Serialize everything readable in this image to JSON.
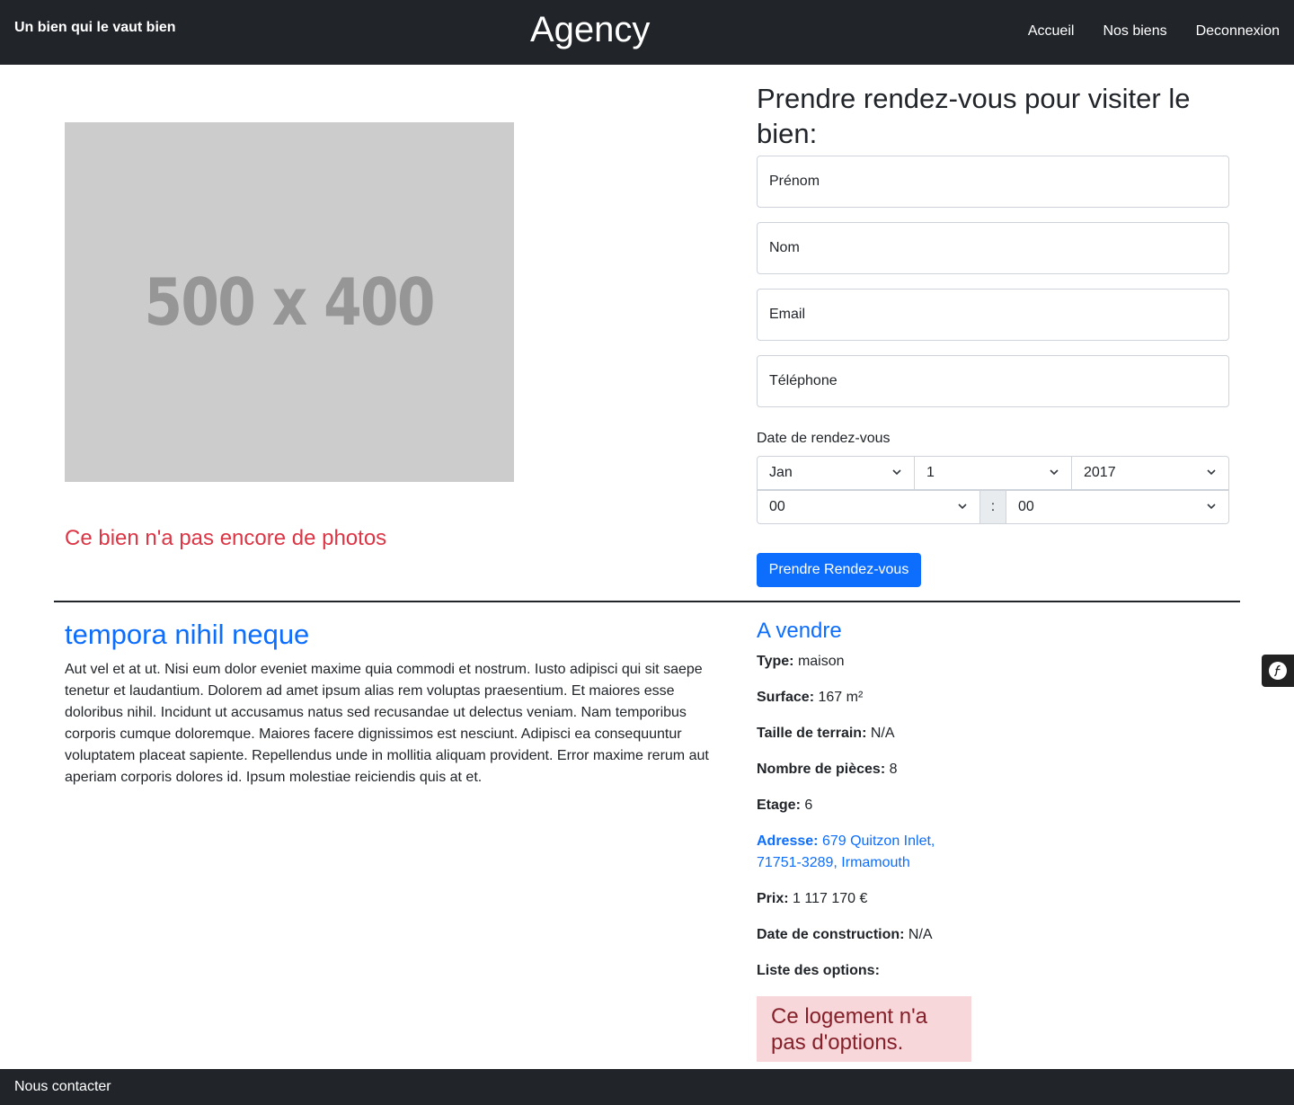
{
  "header": {
    "tagline": "Un bien qui le vaut bien",
    "brand": "Agency",
    "nav": [
      "Accueil",
      "Nos biens",
      "Deconnexion"
    ]
  },
  "gallery": {
    "placeholder_text": "500 x 400",
    "no_photos_text": "Ce bien n'a pas encore de photos"
  },
  "appointment": {
    "title": "Prendre rendez-vous pour visiter le bien:",
    "firstname_placeholder": "Prénom",
    "lastname_placeholder": "Nom",
    "email_placeholder": "Email",
    "phone_placeholder": "Téléphone",
    "date_label": "Date de rendez-vous",
    "month": "Jan",
    "day": "1",
    "year": "2017",
    "hour": "00",
    "time_separator": ":",
    "minute": "00",
    "submit_label": "Prendre Rendez-vous"
  },
  "property": {
    "title": "tempora nihil neque",
    "description": "Aut vel et at ut. Nisi eum dolor eveniet maxime quia commodi et nostrum. Iusto adipisci qui sit saepe tenetur et laudantium. Dolorem ad amet ipsum alias rem voluptas praesentium. Et maiores esse doloribus nihil. Incidunt ut accusamus natus sed recusandae ut delectus veniam. Nam temporibus corporis cumque doloremque. Maiores facere dignissimos est nesciunt. Adipisci ea consequuntur voluptatem placeat sapiente. Repellendus unde in mollitia aliquam provident. Error maxime rerum aut aperiam corporis dolores id. Ipsum molestiae reiciendis quis at et.",
    "status": "A vendre",
    "details": {
      "type_label": "Type:",
      "type_value": "maison",
      "surface_label": "Surface:",
      "surface_value": "167 m²",
      "land_label": "Taille de terrain:",
      "land_value": "N/A",
      "rooms_label": "Nombre de pièces:",
      "rooms_value": "8",
      "floor_label": "Etage:",
      "floor_value": "6",
      "address_label": "Adresse:",
      "address_value": "679 Quitzon Inlet, 71751-3289, Irmamouth",
      "price_label": "Prix:",
      "price_value": "1 117 170 €",
      "built_label": "Date de construction:",
      "built_value": "N/A",
      "options_label": "Liste des options:"
    },
    "no_options_text": "Ce logement n'a pas d'options."
  },
  "footer": {
    "contact": "Nous contacter"
  }
}
